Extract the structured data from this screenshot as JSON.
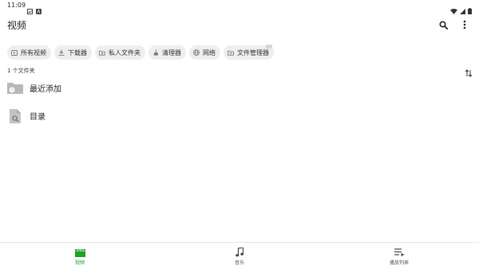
{
  "status_bar": {
    "time": "11:09"
  },
  "app_bar": {
    "title": "视频"
  },
  "chips": [
    {
      "label": "所有视频",
      "icon": "video-icon"
    },
    {
      "label": "下载器",
      "icon": "download-icon"
    },
    {
      "label": "私人文件夹",
      "icon": "folder-lock-icon"
    },
    {
      "label": "清理器",
      "icon": "broom-icon"
    },
    {
      "label": "网络",
      "icon": "globe-icon"
    },
    {
      "label": "文件管理器",
      "icon": "folder-icon"
    }
  ],
  "folder_count": "1 个文件夹",
  "list": [
    {
      "label": "最近添加",
      "icon": "recent-folder-icon"
    },
    {
      "label": "目录",
      "icon": "file-search-icon"
    }
  ],
  "bottom_nav": [
    {
      "label": "视频",
      "icon": "clapperboard-icon",
      "active": true
    },
    {
      "label": "音乐",
      "icon": "music-note-icon",
      "active": false
    },
    {
      "label": "播放列表",
      "icon": "playlist-icon",
      "active": false
    }
  ],
  "colors": {
    "accent": "#1ea31e",
    "chip_bg": "#eeeeee",
    "folder_grey": "#b8b8b8"
  }
}
